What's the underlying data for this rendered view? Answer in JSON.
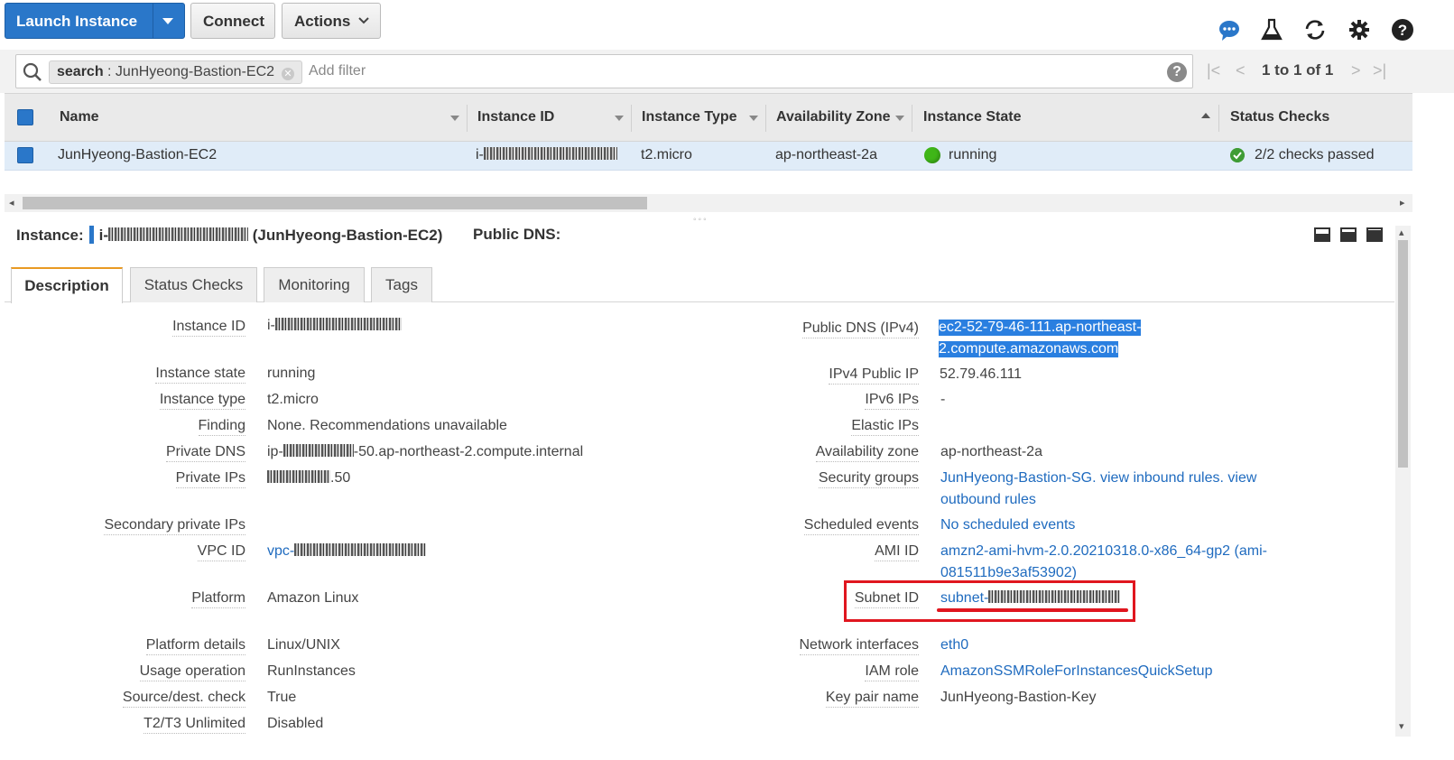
{
  "toolbar": {
    "launch_label": "Launch Instance",
    "connect_label": "Connect",
    "actions_label": "Actions",
    "icons": [
      "chat-icon",
      "flask-icon",
      "refresh-icon",
      "gear-icon",
      "help-icon"
    ]
  },
  "filter": {
    "token_key": "search",
    "token_value": " : JunHyeong-Bastion-EC2",
    "placeholder": "Add filter",
    "help": "?",
    "pagination": "1 to 1 of 1"
  },
  "table": {
    "columns": [
      "Name",
      "Instance ID",
      "Instance Type",
      "Availability Zone",
      "Instance State",
      "Status Checks"
    ],
    "row": {
      "name": "JunHyeong-Bastion-EC2",
      "instance_id_prefix": "i-",
      "instance_type": "t2.micro",
      "availability_zone": "ap-northeast-2a",
      "instance_state": "running",
      "status_checks": "2/2 checks passed"
    }
  },
  "detail": {
    "instance_label": "Instance:",
    "instance_id_prefix": "i-",
    "instance_name": " (JunHyeong-Bastion-EC2)",
    "public_dns_label": "Public DNS:",
    "tabs": [
      "Description",
      "Status Checks",
      "Monitoring",
      "Tags"
    ],
    "left": {
      "instance_id_label": "Instance ID",
      "instance_id_prefix": "i-",
      "instance_state_label": "Instance state",
      "instance_state": "running",
      "instance_type_label": "Instance type",
      "instance_type": "t2.micro",
      "finding_label": "Finding",
      "finding": "None. Recommendations unavailable",
      "private_dns_label": "Private DNS",
      "private_dns_prefix": "ip-",
      "private_dns_suffix": "-50.ap-northeast-2.compute.internal",
      "private_ips_label": "Private IPs",
      "private_ips_suffix": ".50",
      "secondary_ips_label": "Secondary private IPs",
      "vpc_id_label": "VPC ID",
      "vpc_id_prefix": "vpc-",
      "platform_label": "Platform",
      "platform": "Amazon Linux",
      "platform_details_label": "Platform details",
      "platform_details": "Linux/UNIX",
      "usage_operation_label": "Usage operation",
      "usage_operation": "RunInstances",
      "source_dest_label": "Source/dest. check",
      "source_dest": "True",
      "t2t3_label": "T2/T3 Unlimited",
      "t2t3": "Disabled"
    },
    "right": {
      "public_dns_ipv4_label": "Public DNS (IPv4)",
      "public_dns_line1": "ec2-52-79-46-111.ap-northeast-",
      "public_dns_line2": "2.compute.amazonaws.com",
      "ipv4_public_ip_label": "IPv4 Public IP",
      "ipv4_public_ip": "52.79.46.111",
      "ipv6_label": "IPv6 IPs",
      "ipv6": "-",
      "elastic_ips_label": "Elastic IPs",
      "availability_zone_label": "Availability zone",
      "availability_zone": "ap-northeast-2a",
      "security_groups_label": "Security groups",
      "security_group_name": "JunHyeong-Bastion-SG.",
      "view_inbound": "view inbound rules.",
      "view_outbound_a": "view",
      "view_outbound_b": "outbound rules",
      "scheduled_events_label": "Scheduled events",
      "scheduled_events": "No scheduled events",
      "ami_id_label": "AMI ID",
      "ami_line1": "amzn2-ami-hvm-2.0.20210318.0-x86_64-gp2 (ami-",
      "ami_line2": "081511b9e3af53902)",
      "subnet_id_label": "Subnet ID",
      "subnet_prefix": "subnet-",
      "network_interfaces_label": "Network interfaces",
      "network_interfaces": "eth0",
      "iam_role_label": "IAM role",
      "iam_role": "AmazonSSMRoleForInstancesQuickSetup",
      "key_pair_label": "Key pair name",
      "key_pair": "JunHyeong-Bastion-Key"
    }
  },
  "colors": {
    "primary": "#2a77c9",
    "link": "#1f6bbf",
    "running_green": "#3fb618",
    "highlight_red": "#e0161f",
    "selected_row": "#e0ecf8"
  }
}
